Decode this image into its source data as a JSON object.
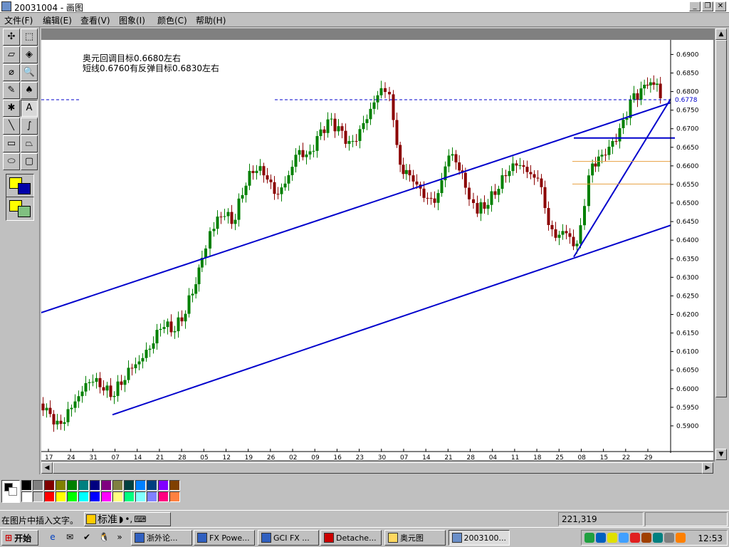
{
  "window": {
    "title": "20031004 - 画图"
  },
  "menu": [
    "文件(F)",
    "编辑(E)",
    "查看(V)",
    "图象(I)",
    "颜色(C)",
    "帮助(H)"
  ],
  "tools": [
    {
      "name": "free-select-tool",
      "glyph": "✣"
    },
    {
      "name": "rect-select-tool",
      "glyph": "⬚"
    },
    {
      "name": "eraser-tool",
      "glyph": "▱"
    },
    {
      "name": "fill-tool",
      "glyph": "◈"
    },
    {
      "name": "pick-color-tool",
      "glyph": "⌀"
    },
    {
      "name": "magnifier-tool",
      "glyph": "🔍"
    },
    {
      "name": "pencil-tool",
      "glyph": "✎"
    },
    {
      "name": "brush-tool",
      "glyph": "♠"
    },
    {
      "name": "airbrush-tool",
      "glyph": "✱"
    },
    {
      "name": "text-tool",
      "glyph": "A"
    },
    {
      "name": "line-tool",
      "glyph": "╲"
    },
    {
      "name": "curve-tool",
      "glyph": "∫"
    },
    {
      "name": "rectangle-tool",
      "glyph": "▭"
    },
    {
      "name": "polygon-tool",
      "glyph": "⏢"
    },
    {
      "name": "ellipse-tool",
      "glyph": "⬭"
    },
    {
      "name": "rounded-rect-tool",
      "glyph": "▢"
    }
  ],
  "chart_data": {
    "type": "candlestick",
    "annotations": [
      "奥元回调目标0.6680左右",
      "短线0.6760有反弹目标0.6830左右"
    ],
    "price_marker": "0.6778",
    "y_ticks": [
      "0.6900",
      "0.6850",
      "0.6800",
      "0.6750",
      "0.6700",
      "0.6650",
      "0.6600",
      "0.6550",
      "0.6500",
      "0.6450",
      "0.6400",
      "0.6350",
      "0.6300",
      "0.6250",
      "0.6200",
      "0.6150",
      "0.6100",
      "0.6050",
      "0.6000",
      "0.5950",
      "0.5900"
    ],
    "ylim": [
      0.585,
      0.692
    ],
    "x_ticks": [
      "17",
      "24",
      "31",
      "07",
      "14",
      "21",
      "28",
      "05",
      "12",
      "19",
      "26",
      "02",
      "09",
      "16",
      "23",
      "30",
      "07",
      "14",
      "21",
      "28",
      "04",
      "11",
      "18",
      "25",
      "08",
      "15",
      "22",
      "29"
    ],
    "dashed_level": 0.6778,
    "horizontal_level": 0.6675,
    "fib_levels": [
      0.6612,
      0.6551
    ],
    "colors": {
      "up": "#008000",
      "down": "#8b0000",
      "trend": "#0000cc",
      "fib": "#e8a040"
    }
  },
  "palette": [
    "#000000",
    "#808080",
    "#800000",
    "#808000",
    "#008000",
    "#008080",
    "#000080",
    "#800080",
    "#808040",
    "#004040",
    "#0080ff",
    "#004080",
    "#8000ff",
    "#804000",
    "#ffffff",
    "#c0c0c0",
    "#ff0000",
    "#ffff00",
    "#00ff00",
    "#00ffff",
    "#0000ff",
    "#ff00ff",
    "#ffff80",
    "#00ff80",
    "#80ffff",
    "#8080ff",
    "#ff0080",
    "#ff8040"
  ],
  "status": {
    "hint": "在图片中插入文字。",
    "ime": "标准",
    "coords": "221,319"
  },
  "taskbar": {
    "start": "开始",
    "tasks": [
      "浙外论...",
      "FX Powe...",
      "GCI FX ...",
      "Detache...",
      "奥元图",
      "2003100..."
    ],
    "clock": "12:53"
  }
}
